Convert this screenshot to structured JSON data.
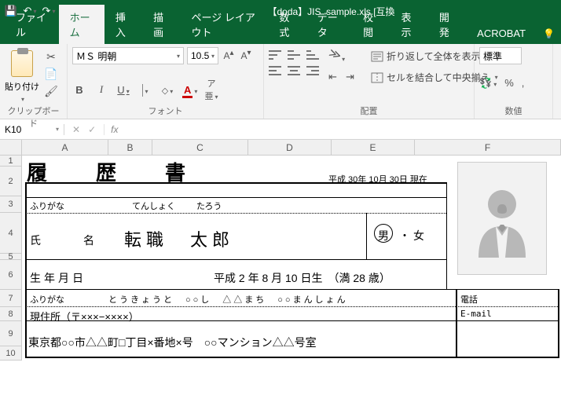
{
  "titlebar": {
    "filename": "【doda】JIS_sample.xls  [互換"
  },
  "tabs": {
    "file": "ファイル",
    "home": "ホーム",
    "insert": "挿入",
    "draw": "描画",
    "pagelayout": "ページ レイアウト",
    "formulas": "数式",
    "data": "データ",
    "review": "校閲",
    "view": "表示",
    "developer": "開発",
    "acrobat": "ACROBAT"
  },
  "ribbon": {
    "clipboard_label": "クリップボード",
    "paste_label": "貼り付け",
    "font_label": "フォント",
    "font_name": "ＭＳ 明朝",
    "font_size": "10.5",
    "alignment_label": "配置",
    "wrap_text": "折り返して全体を表示する",
    "merge_center": "セルを結合して中央揃え",
    "number_label": "数値",
    "number_format": "標準"
  },
  "fxbar": {
    "cell": "K10"
  },
  "columns": {
    "A": "A",
    "B": "B",
    "C": "C",
    "D": "D",
    "E": "E",
    "F": "F"
  },
  "rows": {
    "r1": "1",
    "r2": "2",
    "r3": "3",
    "r4": "4",
    "r5": "5",
    "r6": "6",
    "r7": "7",
    "r8": "8",
    "r9": "9",
    "r10": "10"
  },
  "resume": {
    "title": "履　歴　書",
    "date": "平成 30年 10月 30日 現在",
    "furigana_label": "ふりがな",
    "name_furigana_sei": "てんしょく",
    "name_furigana_mei": "たろう",
    "name_label": "氏　名",
    "name_value": "転職　太郎",
    "gender_male": "男",
    "gender_sep": "・",
    "gender_female": "女",
    "birth_label": "生年月日",
    "birth_value": "平成  2 年  8 月  10 日生　（満 28 歳）",
    "addr_furigana": "とうきょうと　○○し　△△まち　○○まんしょん",
    "addr_label": "現住所（〒×××−××××）",
    "addr_value": "東京都○○市△△町□丁目×番地×号　○○マンション△△号室",
    "tel_label": "電話",
    "email_label": "E-mail"
  }
}
